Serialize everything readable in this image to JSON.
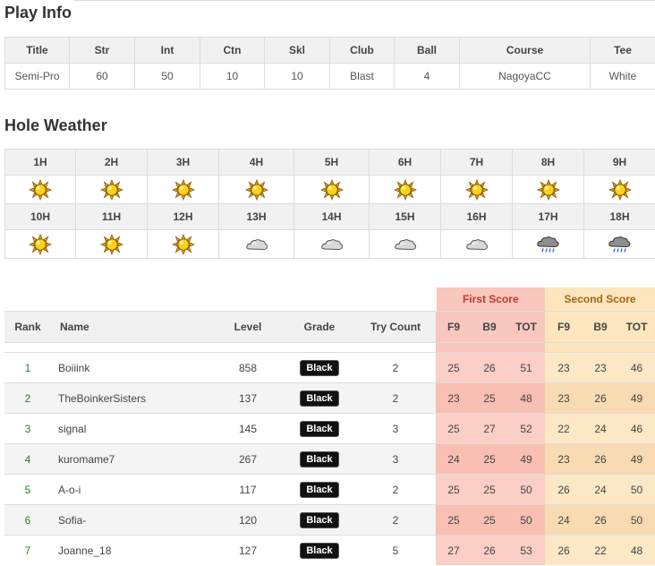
{
  "play_info": {
    "title": "Play Info",
    "headers": [
      "Title",
      "Str",
      "Int",
      "Ctn",
      "Skl",
      "Club",
      "Ball",
      "Course",
      "Tee"
    ],
    "values": [
      "Semi-Pro",
      "60",
      "50",
      "10",
      "10",
      "Blast",
      "4",
      "NagoyaCC",
      "White"
    ]
  },
  "hole_weather": {
    "title": "Hole Weather",
    "rows": [
      {
        "holes": [
          "1H",
          "2H",
          "3H",
          "4H",
          "5H",
          "6H",
          "7H",
          "8H",
          "9H"
        ],
        "icons": [
          "sun-icon",
          "sun-icon",
          "sun-icon",
          "sun-icon",
          "sun-icon",
          "sun-icon",
          "sun-icon",
          "sun-icon",
          "sun-icon"
        ]
      },
      {
        "holes": [
          "10H",
          "11H",
          "12H",
          "13H",
          "14H",
          "15H",
          "16H",
          "17H",
          "18H"
        ],
        "icons": [
          "sun-icon",
          "sun-icon",
          "sun-icon",
          "cloud-icon",
          "cloud-icon",
          "cloud-icon",
          "cloud-icon",
          "rain-icon",
          "rain-icon"
        ]
      }
    ]
  },
  "scores": {
    "first_score_label": "First Score",
    "second_score_label": "Second Score",
    "columns": {
      "rank": "Rank",
      "name": "Name",
      "level": "Level",
      "grade": "Grade",
      "try": "Try Count",
      "f9": "F9",
      "b9": "B9",
      "tot": "TOT",
      "f9b": "F9",
      "b9b": "B9",
      "totb": "TOT"
    },
    "rows": [
      {
        "rank": "1",
        "name": "Boiiink",
        "level": "858",
        "grade": "Black",
        "try": "2",
        "f9": "25",
        "b9": "26",
        "tot": "51",
        "f9b": "23",
        "b9b": "23",
        "totb": "46"
      },
      {
        "rank": "2",
        "name": "TheBoinkerSisters",
        "level": "137",
        "grade": "Black",
        "try": "2",
        "f9": "23",
        "b9": "25",
        "tot": "48",
        "f9b": "23",
        "b9b": "26",
        "totb": "49"
      },
      {
        "rank": "3",
        "name": "signal",
        "level": "145",
        "grade": "Black",
        "try": "3",
        "f9": "25",
        "b9": "27",
        "tot": "52",
        "f9b": "22",
        "b9b": "24",
        "totb": "46"
      },
      {
        "rank": "4",
        "name": "kuromame7",
        "level": "267",
        "grade": "Black",
        "try": "3",
        "f9": "24",
        "b9": "25",
        "tot": "49",
        "f9b": "23",
        "b9b": "26",
        "totb": "49"
      },
      {
        "rank": "5",
        "name": "A-o-i",
        "level": "117",
        "grade": "Black",
        "try": "2",
        "f9": "25",
        "b9": "25",
        "tot": "50",
        "f9b": "26",
        "b9b": "24",
        "totb": "50"
      },
      {
        "rank": "6",
        "name": "Sofia-",
        "level": "120",
        "grade": "Black",
        "try": "2",
        "f9": "25",
        "b9": "25",
        "tot": "50",
        "f9b": "24",
        "b9b": "26",
        "totb": "50"
      },
      {
        "rank": "7",
        "name": "Joanne_18",
        "level": "127",
        "grade": "Black",
        "try": "5",
        "f9": "27",
        "b9": "26",
        "tot": "53",
        "f9b": "26",
        "b9b": "22",
        "totb": "48"
      }
    ]
  }
}
